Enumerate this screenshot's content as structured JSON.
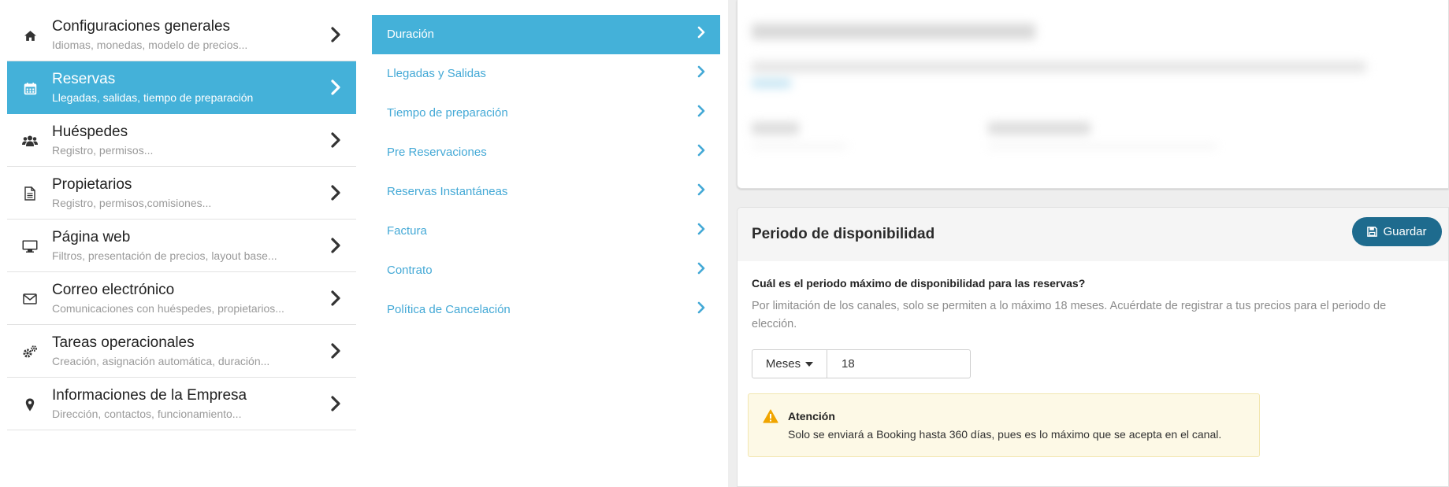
{
  "sidebar": {
    "items": [
      {
        "title": "Configuraciones generales",
        "sub": "Idiomas, monedas, modelo de precios...",
        "icon": "home-icon"
      },
      {
        "title": "Reservas",
        "sub": "Llegadas, salidas, tiempo de preparación",
        "icon": "calendar-icon"
      },
      {
        "title": "Huéspedes",
        "sub": "Registro, permisos...",
        "icon": "users-icon"
      },
      {
        "title": "Propietarios",
        "sub": "Registro, permisos,comisiones...",
        "icon": "document-icon"
      },
      {
        "title": "Página web",
        "sub": "Filtros, presentación de precios, layout base...",
        "icon": "monitor-icon"
      },
      {
        "title": "Correo electrónico",
        "sub": "Comunicaciones con huéspedes, propietarios...",
        "icon": "envelope-icon"
      },
      {
        "title": "Tareas operacionales",
        "sub": "Creación, asignación automática, duración...",
        "icon": "gears-icon"
      },
      {
        "title": "Informaciones de la Empresa",
        "sub": "Dirección, contactos, funcionamiento...",
        "icon": "map-pin-icon"
      }
    ],
    "active_index": 1
  },
  "submenu": {
    "items": [
      "Duración",
      "Llegadas y Salidas",
      "Tiempo de preparación",
      "Pre Reservaciones",
      "Reservas Instantáneas",
      "Factura",
      "Contrato",
      "Política de Cancelación"
    ],
    "active_index": 0
  },
  "disponibilidad": {
    "title": "Periodo de disponibilidad",
    "save_label": "Guardar",
    "question": "Cuál es el periodo máximo de disponibilidad para las reservas?",
    "help": "Por limitación de los canales, solo se permiten a lo máximo 18 meses. Acuérdate de registrar a tus precios para el periodo de elección.",
    "unit_label": "Meses",
    "value": "18",
    "alert": {
      "title": "Atención",
      "message": "Solo se enviará a Booking hasta 360 días, pues es lo máximo que se acepta en el canal."
    }
  },
  "colors": {
    "accent": "#44b1d9",
    "link": "#44a9d6",
    "save_button": "#1e6b8e",
    "alert_bg": "#fdf9e6",
    "warning": "#f0a500"
  }
}
